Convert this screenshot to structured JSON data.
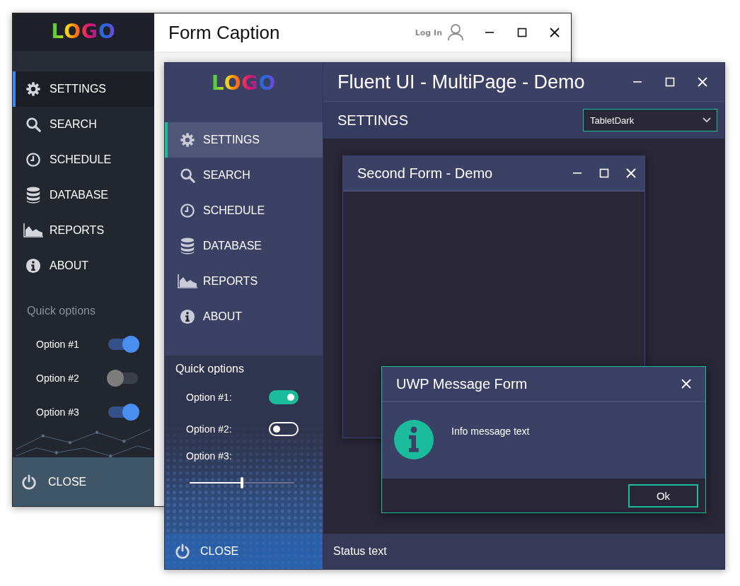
{
  "back_window": {
    "logo": "LOGO",
    "nav": [
      {
        "label": "SETTINGS",
        "selected": true
      },
      {
        "label": "SEARCH",
        "selected": false
      },
      {
        "label": "SCHEDULE",
        "selected": false
      },
      {
        "label": "DATABASE",
        "selected": false
      },
      {
        "label": "REPORTS",
        "selected": false
      },
      {
        "label": "ABOUT",
        "selected": false
      }
    ],
    "quick_options": {
      "title": "Quick options",
      "options": [
        {
          "label": "Option #1",
          "on": true
        },
        {
          "label": "Option #2",
          "on": false
        },
        {
          "label": "Option #3",
          "on": true
        }
      ]
    },
    "close": "CLOSE",
    "title": "Form Caption",
    "login": "Log In"
  },
  "main_window": {
    "logo": "LOGO",
    "nav": [
      {
        "label": "SETTINGS",
        "selected": true
      },
      {
        "label": "SEARCH",
        "selected": false
      },
      {
        "label": "SCHEDULE",
        "selected": false
      },
      {
        "label": "DATABASE",
        "selected": false
      },
      {
        "label": "REPORTS",
        "selected": false
      },
      {
        "label": "ABOUT",
        "selected": false
      }
    ],
    "quick_options": {
      "title": "Quick options",
      "options": [
        {
          "kind": "toggle",
          "label": "Option #1:",
          "on": true
        },
        {
          "kind": "toggle",
          "label": "Option #2:",
          "on": false
        },
        {
          "kind": "slider",
          "label": "Option #3:",
          "level": 0.5
        }
      ]
    },
    "close": "CLOSE",
    "title": "Fluent UI - MultiPage - Demo",
    "page_title": "SETTINGS",
    "theme_dropdown": {
      "value": "TabletDark"
    },
    "second_form": {
      "title": "Second Form - Demo"
    },
    "message_form": {
      "title": "UWP Message Form",
      "message": "Info message text",
      "buttons": [
        "Ok"
      ]
    },
    "status_bar": "Status text"
  }
}
